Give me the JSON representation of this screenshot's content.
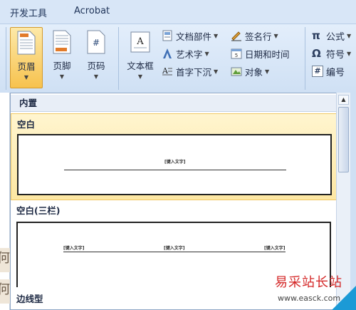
{
  "tabs": [
    {
      "label": "开发工具"
    },
    {
      "label": "Acrobat"
    }
  ],
  "ribbon": {
    "header_footer": [
      {
        "label": "页眉",
        "icon": "header-icon",
        "active": true
      },
      {
        "label": "页脚",
        "icon": "footer-icon",
        "active": false
      },
      {
        "label": "页码",
        "icon": "page-number-icon",
        "active": false
      }
    ],
    "textbox": {
      "label": "文本框",
      "icon": "textbox-icon"
    },
    "text_small": [
      {
        "label": "文档部件",
        "icon": "quick-parts-icon"
      },
      {
        "label": "艺术字",
        "icon": "wordart-icon"
      },
      {
        "label": "首字下沉",
        "icon": "drop-cap-icon"
      }
    ],
    "text_small2": [
      {
        "label": "签名行",
        "icon": "signature-line-icon"
      },
      {
        "label": "日期和时间",
        "icon": "date-time-icon"
      },
      {
        "label": "对象",
        "icon": "object-icon"
      }
    ],
    "symbols": [
      {
        "label": "公式",
        "icon": "equation-icon",
        "glyph": "π"
      },
      {
        "label": "符号",
        "icon": "symbol-icon",
        "glyph": "Ω"
      },
      {
        "label": "编号",
        "icon": "numbering-icon",
        "glyph": "#"
      }
    ]
  },
  "gallery": {
    "section_builtin": "内置",
    "items": [
      {
        "title": "空白",
        "placeholders": [
          "[键入文字]"
        ]
      },
      {
        "title": "空白(三栏)",
        "placeholders": [
          "[键入文字]",
          "[键入文字]",
          "[键入文字]"
        ]
      }
    ],
    "section_border": "边线型"
  },
  "doc_glyphs": [
    "何",
    "何"
  ],
  "watermark": {
    "name": "易采站长站",
    "url": "www.easck.com"
  },
  "colors": {
    "accent": "#f7c24e",
    "watermark_red": "#d42828",
    "watermark_blue": "#1c9ad6"
  }
}
